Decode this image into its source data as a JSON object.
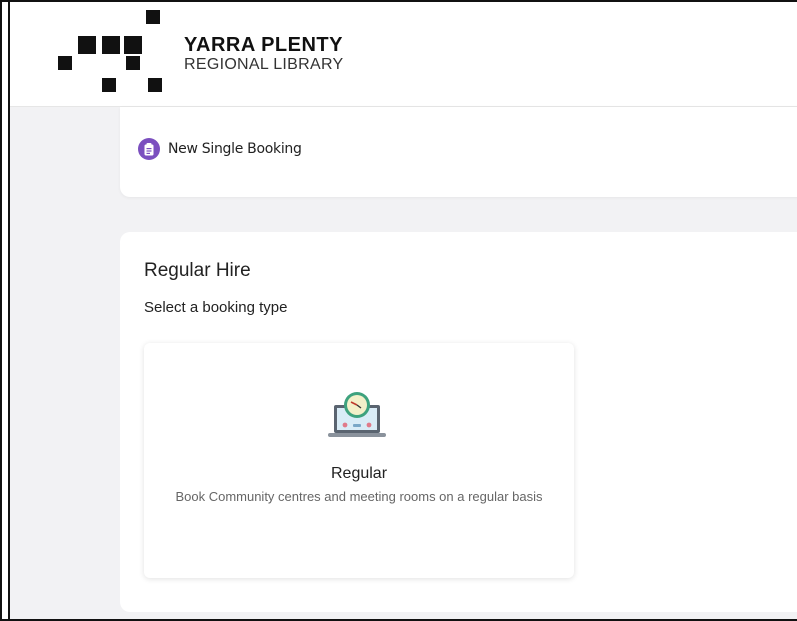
{
  "brand": {
    "line1": "YARRA PLENTY",
    "line2": "REGIONAL LIBRARY",
    "mark_color": "#111111"
  },
  "quick_actions": {
    "new_single_booking": {
      "label": "New Single Booking",
      "icon": "clipboard-icon",
      "icon_color": "#7b4fbf"
    }
  },
  "section": {
    "title": "Regular Hire",
    "subtitle": "Select a booking type"
  },
  "booking_types": [
    {
      "title": "Regular",
      "description": "Book Community centres and meeting rooms on a regular basis",
      "icon": "laptop-clock-icon"
    }
  ],
  "colors": {
    "background": "#f2f2f4",
    "card": "#ffffff",
    "accent": "#7b4fbf"
  }
}
